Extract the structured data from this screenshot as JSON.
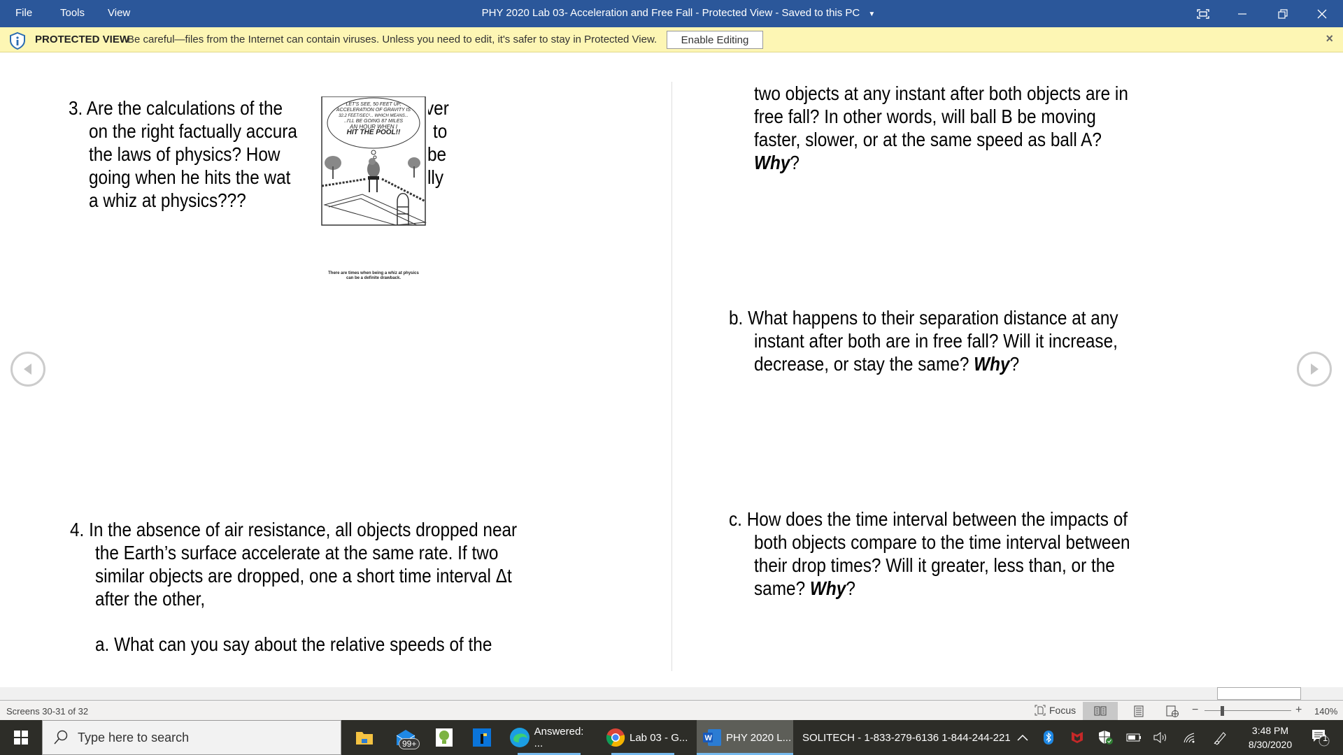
{
  "titlebar": {
    "menu": [
      "File",
      "Tools",
      "View"
    ],
    "title": "PHY 2020 Lab 03-  Acceleration and Free Fall  -  Protected View  -  Saved to this PC",
    "controls": [
      "focus-mode",
      "minimize",
      "restore",
      "close"
    ]
  },
  "protected_view": {
    "label": "PROTECTED VIEW",
    "message": "Be careful—files from the Internet can contain viruses. Unless you need to edit, it's safer to stay in Protected View.",
    "button": "Enable Editing",
    "close": "×"
  },
  "document": {
    "left_page": {
      "q3_lines": [
        "3. Are  the  calculations  of  the",
        "on the right factually accura",
        "the  laws  of  physics?  How",
        "going when he hits the wat",
        "a whiz  at physics???"
      ],
      "q3_right_fragments": [
        "ver",
        "to",
        "be",
        "lly"
      ],
      "cartoon": {
        "bubble": [
          "LET'S SEE, 50 FEET UP,",
          "ACCELERATION OF GRAVITY IS",
          "32.2 FEET/SEC²... WHICH MEANS...",
          "..I'LL BE GOING 87 MILES",
          "AN HOUR WHEN I",
          "HIT THE POOL!!"
        ],
        "caption": [
          "There are times when being a whiz at physics",
          "can be a definite drawback."
        ]
      },
      "q4_lines": [
        "4. In the absence of air resistance, all objects dropped near",
        "the Earth’s surface accelerate at the same rate. If two",
        "similar objects are dropped, one a short time interval Δt",
        "after the other,"
      ],
      "qa": "a. What can you say about the relative speeds of the"
    },
    "right_page": {
      "qa_cont": [
        "two objects at any instant after both objects are in",
        "free fall?  In other words, will ball B be moving",
        "faster, slower, or at the same speed as ball A?"
      ],
      "why": "Why",
      "qmark": "?",
      "qb": [
        "b. What happens to their separation distance at any",
        "instant after both are in free fall? Will it increase,",
        "decrease, or stay the same? "
      ],
      "qc": [
        "c. How does the time interval between the impacts of",
        "both objects compare to the time interval between",
        "their drop times?  Will it greater, less than, or the",
        "same? "
      ]
    }
  },
  "statusbar": {
    "screens": "Screens 30-31 of 32",
    "focus": "Focus",
    "zoom_minus": "−",
    "zoom_plus": "+",
    "zoom": "140%",
    "zoom_value_percent": 140
  },
  "taskbar": {
    "search_placeholder": "Type here to search",
    "mail_badge": "99+",
    "apps": [
      {
        "label": "Answered: ..."
      },
      {
        "label": "Lab 03 - G..."
      },
      {
        "label": "PHY 2020 L..."
      }
    ],
    "solitech": "SOLITECH - 1-833-279-6136 1-844-244-221",
    "time": "3:48 PM",
    "date": "8/30/2020",
    "notifications": "1"
  }
}
